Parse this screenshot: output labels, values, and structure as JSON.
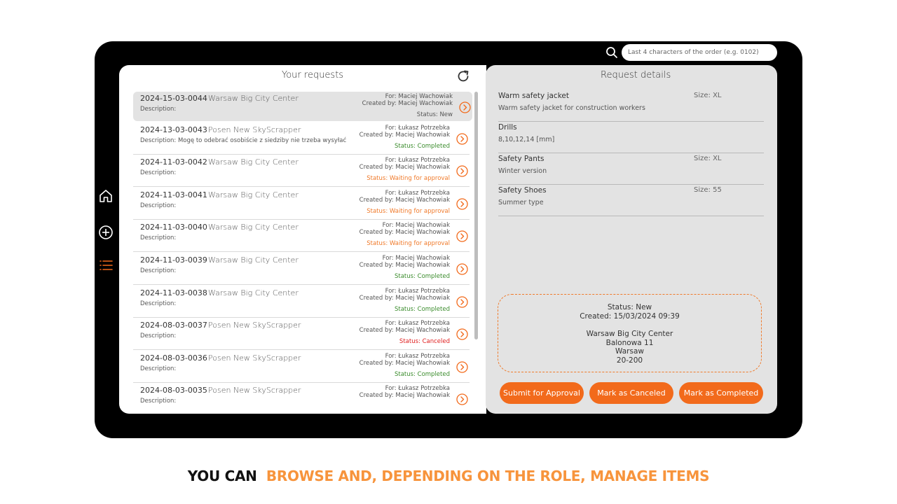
{
  "search": {
    "placeholder": "Last 4 characters of the order (e.g. 0102)"
  },
  "nav": {
    "items": [
      "home-icon",
      "add-icon",
      "list-icon"
    ],
    "active": "list-icon"
  },
  "left": {
    "title": "Your requests"
  },
  "requests": [
    {
      "id": "2024-15-03-0044",
      "location": "Warsaw Big City Center",
      "description": "Description:",
      "for": "For: Maciej Wachowiak",
      "created_by": "Created by: Maciej Wachowiak",
      "status": "Status: New",
      "status_type": "new"
    },
    {
      "id": "2024-13-03-0043",
      "location": "Posen New SkyScrapper",
      "description": "Description: Mogę to odebrać osobiście z siedziby nie trzeba wysyłać",
      "for": "For: Łukasz Potrzebka",
      "created_by": "Created by: Maciej Wachowiak",
      "status": "Status: Completed",
      "status_type": "completed"
    },
    {
      "id": "2024-11-03-0042",
      "location": "Warsaw Big City Center",
      "description": "Description:",
      "for": "For: Łukasz Potrzebka",
      "created_by": "Created by: Maciej Wachowiak",
      "status": "Status: Waiting for approval",
      "status_type": "waiting"
    },
    {
      "id": "2024-11-03-0041",
      "location": "Warsaw Big City Center",
      "description": "Description:",
      "for": "For: Łukasz Potrzebka",
      "created_by": "Created by: Maciej Wachowiak",
      "status": "Status: Waiting for approval",
      "status_type": "waiting"
    },
    {
      "id": "2024-11-03-0040",
      "location": "Warsaw Big City Center",
      "description": "Description:",
      "for": "For: Maciej Wachowiak",
      "created_by": "Created by: Maciej Wachowiak",
      "status": "Status: Waiting for approval",
      "status_type": "waiting"
    },
    {
      "id": "2024-11-03-0039",
      "location": "Warsaw Big City Center",
      "description": "Description:",
      "for": "For: Maciej Wachowiak",
      "created_by": "Created by: Maciej Wachowiak",
      "status": "Status: Completed",
      "status_type": "completed"
    },
    {
      "id": "2024-11-03-0038",
      "location": "Warsaw Big City Center",
      "description": "Description:",
      "for": "For: Łukasz Potrzebka",
      "created_by": "Created by: Maciej Wachowiak",
      "status": "Status: Completed",
      "status_type": "completed"
    },
    {
      "id": "2024-08-03-0037",
      "location": "Posen New SkyScrapper",
      "description": "Description:",
      "for": "For: Łukasz Potrzebka",
      "created_by": "Created by: Maciej Wachowiak",
      "status": "Status: Canceled",
      "status_type": "canceled"
    },
    {
      "id": "2024-08-03-0036",
      "location": "Posen New SkyScrapper",
      "description": "Description:",
      "for": "For: Łukasz Potrzebka",
      "created_by": "Created by: Maciej Wachowiak",
      "status": "Status: Completed",
      "status_type": "completed"
    },
    {
      "id": "2024-08-03-0035",
      "location": "Posen New SkyScrapper",
      "description": "Description:",
      "for": "For: Łukasz Potrzebka",
      "created_by": "Created by: Maciej Wachowiak",
      "status": "",
      "status_type": "completed"
    }
  ],
  "details": {
    "title": "Request details",
    "items": [
      {
        "name": "Warm safety jacket",
        "size": "Size: XL",
        "detail": "Warm safety jacket for construction workers"
      },
      {
        "name": "Drills",
        "size": "",
        "detail": "8,10,12,14 [mm]"
      },
      {
        "name": "Safety Pants",
        "size": "Size: XL",
        "detail": "Winter version"
      },
      {
        "name": "Safety Shoes",
        "size": "Size: 55",
        "detail": "Summer type"
      }
    ],
    "info": {
      "status": "Status: New",
      "created": "Created: 15/03/2024 09:39",
      "site": "Warsaw Big City Center",
      "street": "Balonowa 11",
      "city": "Warsaw",
      "postal": "20-200"
    },
    "buttons": {
      "submit": "Submit for Approval",
      "cancel": "Mark as Canceled",
      "complete": "Mark as Completed"
    }
  },
  "colors": {
    "accent": "#f26a1b",
    "completed": "#3a8c2c",
    "waiting": "#f07a2a",
    "canceled": "#e02020"
  },
  "tagline": {
    "part1": "YOU CAN",
    "part2": "BROWSE AND, DEPENDING ON THE ROLE, MANAGE ITEMS"
  }
}
